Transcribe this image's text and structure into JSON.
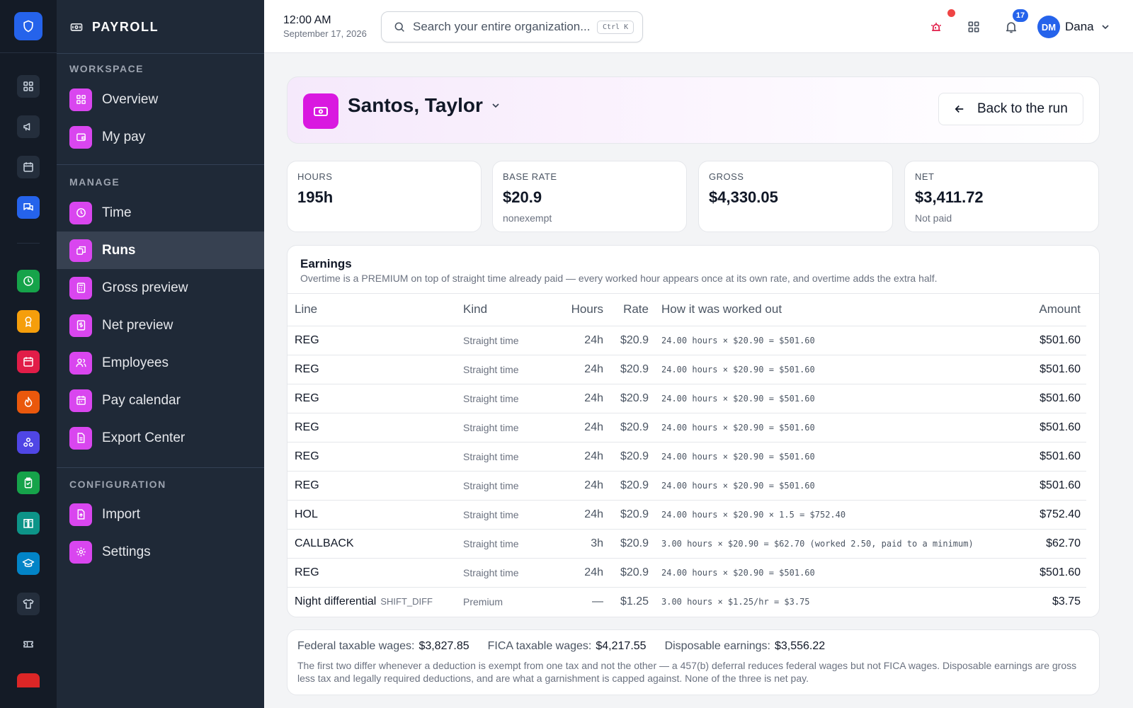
{
  "app": {
    "name": "PAYROLL"
  },
  "topbar": {
    "time": "12:00 AM",
    "date": "September 17, 2026",
    "search_placeholder": "Search your entire organization...",
    "search_shortcut": "Ctrl K",
    "notification_count": "17",
    "user_initials": "DM",
    "user_name": "Dana"
  },
  "sidebar": {
    "sections": [
      {
        "label": "WORKSPACE",
        "items": [
          {
            "label": "Overview",
            "icon": "grid-icon"
          },
          {
            "label": "My pay",
            "icon": "wallet-icon"
          }
        ]
      },
      {
        "label": "MANAGE",
        "items": [
          {
            "label": "Time",
            "icon": "clock-icon"
          },
          {
            "label": "Runs",
            "icon": "runs-icon",
            "active": true
          },
          {
            "label": "Gross preview",
            "icon": "calculator-icon"
          },
          {
            "label": "Net preview",
            "icon": "dollar-doc-icon"
          },
          {
            "label": "Employees",
            "icon": "users-icon"
          },
          {
            "label": "Pay calendar",
            "icon": "calendar-icon"
          },
          {
            "label": "Export Center",
            "icon": "export-doc-icon"
          }
        ]
      },
      {
        "label": "CONFIGURATION",
        "items": [
          {
            "label": "Import",
            "icon": "import-icon"
          },
          {
            "label": "Settings",
            "icon": "gear-icon"
          }
        ]
      }
    ]
  },
  "rail": {
    "colors": {
      "blue": "#2563eb",
      "green": "#16a34a",
      "amber": "#f59e0b",
      "red": "#e11d48",
      "orange": "#ea580c",
      "indigo": "#4f46e5",
      "teal": "#0d9488",
      "sky": "#0284c7"
    }
  },
  "employee": {
    "name": "Santos, Taylor",
    "back_label": "Back to the run"
  },
  "stats": [
    {
      "label": "HOURS",
      "value": "195h",
      "sub": ""
    },
    {
      "label": "BASE RATE",
      "value": "$20.9",
      "sub": "nonexempt"
    },
    {
      "label": "GROSS",
      "value": "$4,330.05",
      "sub": ""
    },
    {
      "label": "NET",
      "value": "$3,411.72",
      "sub": "Not paid"
    }
  ],
  "earnings": {
    "title": "Earnings",
    "subtitle": "Overtime is a PREMIUM on top of straight time already paid — every worked hour appears once at its own rate, and overtime adds the extra half.",
    "columns": {
      "line": "Line",
      "kind": "Kind",
      "hours": "Hours",
      "rate": "Rate",
      "how": "How it was worked out",
      "amount": "Amount"
    },
    "rows": [
      {
        "line": "REG",
        "code": "",
        "kind": "Straight time",
        "hours": "24h",
        "rate": "$20.9",
        "how": "24.00 hours × $20.90 = $501.60",
        "amount": "$501.60"
      },
      {
        "line": "REG",
        "code": "",
        "kind": "Straight time",
        "hours": "24h",
        "rate": "$20.9",
        "how": "24.00 hours × $20.90 = $501.60",
        "amount": "$501.60"
      },
      {
        "line": "REG",
        "code": "",
        "kind": "Straight time",
        "hours": "24h",
        "rate": "$20.9",
        "how": "24.00 hours × $20.90 = $501.60",
        "amount": "$501.60"
      },
      {
        "line": "REG",
        "code": "",
        "kind": "Straight time",
        "hours": "24h",
        "rate": "$20.9",
        "how": "24.00 hours × $20.90 = $501.60",
        "amount": "$501.60"
      },
      {
        "line": "REG",
        "code": "",
        "kind": "Straight time",
        "hours": "24h",
        "rate": "$20.9",
        "how": "24.00 hours × $20.90 = $501.60",
        "amount": "$501.60"
      },
      {
        "line": "REG",
        "code": "",
        "kind": "Straight time",
        "hours": "24h",
        "rate": "$20.9",
        "how": "24.00 hours × $20.90 = $501.60",
        "amount": "$501.60"
      },
      {
        "line": "HOL",
        "code": "",
        "kind": "Straight time",
        "hours": "24h",
        "rate": "$20.9",
        "how": "24.00 hours × $20.90 × 1.5 = $752.40",
        "amount": "$752.40"
      },
      {
        "line": "CALLBACK",
        "code": "",
        "kind": "Straight time",
        "hours": "3h",
        "rate": "$20.9",
        "how": "3.00 hours × $20.90 = $62.70 (worked 2.50, paid to a minimum)",
        "amount": "$62.70"
      },
      {
        "line": "REG",
        "code": "",
        "kind": "Straight time",
        "hours": "24h",
        "rate": "$20.9",
        "how": "24.00 hours × $20.90 = $501.60",
        "amount": "$501.60"
      },
      {
        "line": "Night differential",
        "code": "SHIFT_DIFF",
        "kind": "Premium",
        "hours": "—",
        "rate": "$1.25",
        "how": "3.00 hours × $1.25/hr = $3.75",
        "amount": "$3.75"
      }
    ]
  },
  "wages": {
    "federal_label": "Federal taxable wages:",
    "federal_value": "$3,827.85",
    "fica_label": "FICA taxable wages:",
    "fica_value": "$4,217.55",
    "disposable_label": "Disposable earnings:",
    "disposable_value": "$3,556.22",
    "note": "The first two differ whenever a deduction is exempt from one tax and not the other — a 457(b) deferral reduces federal wages but not FICA wages. Disposable earnings are gross less tax and legally required deductions, and are what a garnishment is capped against. None of the three is net pay."
  }
}
